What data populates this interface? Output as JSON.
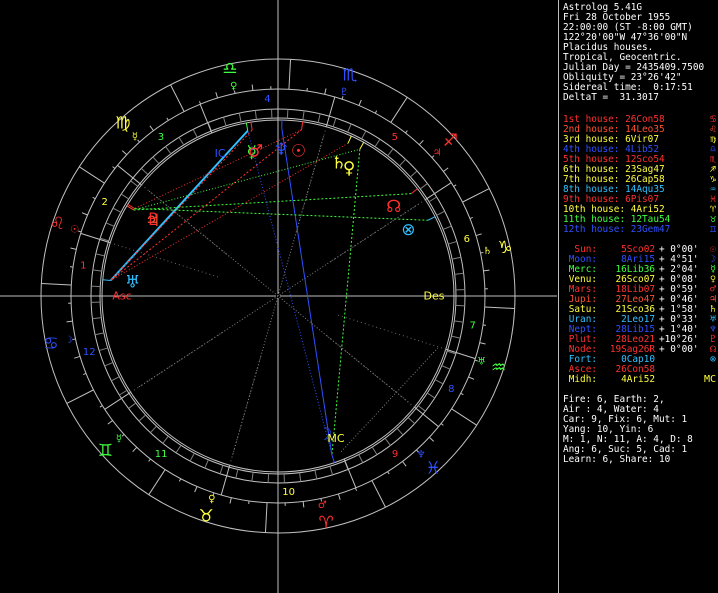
{
  "header": {
    "lines": [
      "Astrolog 5.41G",
      "Fri 28 October 1955",
      "22:00:00 (ST -8:00 GMT)",
      "122°20'00\"W 47°36'00\"N",
      "Placidus houses.",
      "Tropical, Geocentric.",
      "Julian Day = 2435409.7500",
      "Obliquity = 23°26'42\"",
      "Sidereal time:  0:17:51",
      "DeltaT =  31.3017"
    ]
  },
  "houses": [
    {
      "label": "1st house:",
      "value": "26Con58",
      "color": "#ff3030",
      "glyph": "♋"
    },
    {
      "label": "2nd house:",
      "value": "14Leo35",
      "color": "#ff5030",
      "glyph": "♌"
    },
    {
      "label": "3rd house:",
      "value": "6Vir07",
      "color": "#ffff40",
      "glyph": "♍"
    },
    {
      "label": "4th house:",
      "value": "4Lib52",
      "color": "#3050ff",
      "glyph": "♎"
    },
    {
      "label": "5th house:",
      "value": "12Sco54",
      "color": "#ff3030",
      "glyph": "♏"
    },
    {
      "label": "6th house:",
      "value": "23Sag47",
      "color": "#ffff40",
      "glyph": "♐"
    },
    {
      "label": "7th house:",
      "value": "26Cap58",
      "color": "#ffff40",
      "glyph": "♑"
    },
    {
      "label": "8th house:",
      "value": "14Aqu35",
      "color": "#30c0ff",
      "glyph": "♒"
    },
    {
      "label": "9th house:",
      "value": "6Pis07",
      "color": "#ff3030",
      "glyph": "♓"
    },
    {
      "label": "10th house:",
      "value": "4Ari52",
      "color": "#ffff40",
      "glyph": "♈"
    },
    {
      "label": "11th house:",
      "value": "12Tau54",
      "color": "#40ff40",
      "glyph": "♉"
    },
    {
      "label": "12th house:",
      "value": "23Gem47",
      "color": "#3050ff",
      "glyph": "♊"
    }
  ],
  "planets": [
    {
      "label": "Sun:",
      "value": "5Sco02",
      "aspect": "+ 0°00'",
      "color": "#ff3030",
      "glyph": "☉"
    },
    {
      "label": "Moon:",
      "value": "8Ari15",
      "aspect": "+ 4°51'",
      "color": "#3050ff",
      "glyph": "☽"
    },
    {
      "label": "Merc:",
      "value": "16Lib36",
      "aspect": "+ 2°04'",
      "color": "#40ff40",
      "glyph": "☿"
    },
    {
      "label": "Venu:",
      "value": "26Sco07",
      "aspect": "+ 0°08'",
      "color": "#ffff40",
      "glyph": "♀"
    },
    {
      "label": "Mars:",
      "value": "18Lib07",
      "aspect": "+ 0°59'",
      "color": "#ff3030",
      "glyph": "♂"
    },
    {
      "label": "Jupi:",
      "value": "27Leo47",
      "aspect": "+ 0°46'",
      "color": "#ff5030",
      "glyph": "♃"
    },
    {
      "label": "Satu:",
      "value": "21Sco36",
      "aspect": "+ 1°58'",
      "color": "#ffff40",
      "glyph": "♄"
    },
    {
      "label": "Uran:",
      "value": "2Leo17",
      "aspect": "+ 0°33'",
      "color": "#30c0ff",
      "glyph": "♅"
    },
    {
      "label": "Nept:",
      "value": "28Lib15",
      "aspect": "+ 1°40'",
      "color": "#3050ff",
      "glyph": "♆"
    },
    {
      "label": "Plut:",
      "value": "28Leo21",
      "aspect": "+10°26'",
      "color": "#ff3030",
      "glyph": "♇"
    },
    {
      "label": "Node:",
      "value": "19Sag26R",
      "aspect": "+ 0°00'",
      "color": "#ff3030",
      "glyph": "☊"
    },
    {
      "label": "Fort:",
      "value": "0Cap10",
      "aspect": "",
      "color": "#30c0ff",
      "glyph": "⊗"
    },
    {
      "label": "Asce:",
      "value": "26Con58",
      "aspect": "",
      "color": "#ff3030",
      "glyph": ""
    },
    {
      "label": "Midh:",
      "value": "4Ari52",
      "aspect": "",
      "color": "#ffff40",
      "glyph": "MC"
    }
  ],
  "stats": [
    "Fire: 6, Earth: 2,",
    "Air : 4, Water: 4",
    "Car: 9, Fix: 6, Mut: 1",
    "Yang: 10, Yin: 6",
    "M: 1, N: 11, A: 4, D: 8",
    "Ang: 6, Suc: 5, Cad: 1",
    "Learn: 6, Share: 10"
  ],
  "chart": {
    "house_numbers": [
      "1",
      "2",
      "3",
      "4",
      "5",
      "6",
      "7",
      "8",
      "9",
      "10",
      "11",
      "12"
    ],
    "angle_labels": {
      "asc": "Asc",
      "des": "Des",
      "mc": "MC",
      "ic": "IC"
    },
    "zodiac": [
      {
        "glyph": "♈",
        "color": "#ff3030"
      },
      {
        "glyph": "♉",
        "color": "#ffff40"
      },
      {
        "glyph": "♊",
        "color": "#40ff40"
      },
      {
        "glyph": "♋",
        "color": "#3050ff"
      },
      {
        "glyph": "♌",
        "color": "#ff3030"
      },
      {
        "glyph": "♍",
        "color": "#ffff40"
      },
      {
        "glyph": "♎",
        "color": "#40ff40"
      },
      {
        "glyph": "♏",
        "color": "#3050ff"
      },
      {
        "glyph": "♐",
        "color": "#ff3030"
      },
      {
        "glyph": "♑",
        "color": "#ffff40"
      },
      {
        "glyph": "♒",
        "color": "#40ff40"
      },
      {
        "glyph": "♓",
        "color": "#3050ff"
      }
    ],
    "rulers": [
      {
        "glyph": "♂",
        "color": "#ff3030"
      },
      {
        "glyph": "♀",
        "color": "#ffff40"
      },
      {
        "glyph": "☿",
        "color": "#40ff40"
      },
      {
        "glyph": "☽",
        "color": "#3050ff"
      },
      {
        "glyph": "☉",
        "color": "#ff3030"
      },
      {
        "glyph": "☿",
        "color": "#ffff40"
      },
      {
        "glyph": "♀",
        "color": "#40ff40"
      },
      {
        "glyph": "♇",
        "color": "#3050ff"
      },
      {
        "glyph": "♃",
        "color": "#ff3030"
      },
      {
        "glyph": "♄",
        "color": "#ffff40"
      },
      {
        "glyph": "♅",
        "color": "#40ff40"
      },
      {
        "glyph": "♆",
        "color": "#3050ff"
      }
    ],
    "positions": [
      {
        "name": "Sun",
        "glyph": "☉",
        "lon": 215.03,
        "color": "#ff3030"
      },
      {
        "name": "Moon",
        "glyph": "☽",
        "lon": 8.25,
        "color": "#3050ff"
      },
      {
        "name": "Mercury",
        "glyph": "☿",
        "lon": 196.6,
        "color": "#40ff40"
      },
      {
        "name": "Venus",
        "glyph": "♀",
        "lon": 236.12,
        "color": "#ffff40"
      },
      {
        "name": "Mars",
        "glyph": "♂",
        "lon": 198.12,
        "color": "#ff3030"
      },
      {
        "name": "Jupiter",
        "glyph": "♃",
        "lon": 147.78,
        "color": "#ff5030"
      },
      {
        "name": "Saturn",
        "glyph": "♄",
        "lon": 231.6,
        "color": "#ffff40"
      },
      {
        "name": "Uranus",
        "glyph": "♅",
        "lon": 122.28,
        "color": "#30c0ff"
      },
      {
        "name": "Neptune",
        "glyph": "♆",
        "lon": 208.25,
        "color": "#3050ff"
      },
      {
        "name": "Pluto",
        "glyph": "♇",
        "lon": 148.35,
        "color": "#ff3030"
      },
      {
        "name": "Node",
        "glyph": "☊",
        "lon": 259.43,
        "color": "#ff3030"
      },
      {
        "name": "Fortune",
        "glyph": "⊗",
        "lon": 270.17,
        "color": "#30c0ff"
      }
    ]
  }
}
